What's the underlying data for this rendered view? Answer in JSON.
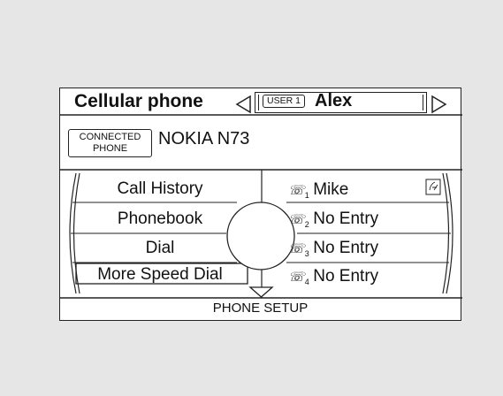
{
  "header": {
    "title": "Cellular phone",
    "user_badge": "USER 1",
    "user_name": "Alex"
  },
  "connection": {
    "badge_line1": "CONNECTED",
    "badge_line2": "PHONE",
    "device": "NOKIA N73"
  },
  "menu": {
    "items": [
      {
        "label": "Call History"
      },
      {
        "label": "Phonebook"
      },
      {
        "label": "Dial"
      },
      {
        "label": "More Speed Dial"
      }
    ]
  },
  "speed_dial": {
    "entries": [
      {
        "slot": "1",
        "name": "Mike",
        "icon": "voice-tag-icon"
      },
      {
        "slot": "2",
        "name": "No Entry"
      },
      {
        "slot": "3",
        "name": "No Entry"
      },
      {
        "slot": "4",
        "name": "No Entry"
      }
    ]
  },
  "footer": {
    "label": "PHONE SETUP"
  },
  "icons": {
    "left": "arrow-left-icon",
    "right": "arrow-right-icon",
    "down": "arrow-down-icon",
    "phone": "handset-icon"
  }
}
